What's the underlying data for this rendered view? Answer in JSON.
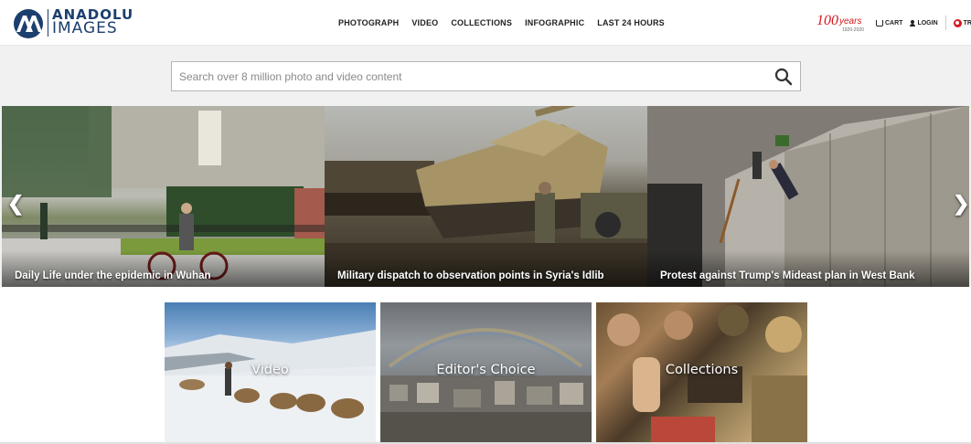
{
  "brand": {
    "line1": "ANADOLU",
    "line2": "IMAGES",
    "logo_mark": "AA"
  },
  "nav": [
    {
      "label": "PHOTOGRAPH"
    },
    {
      "label": "VIDEO"
    },
    {
      "label": "COLLECTIONS"
    },
    {
      "label": "INFOGRAPHIC"
    },
    {
      "label": "LAST 24 HOURS"
    }
  ],
  "anniversary": {
    "number": "100",
    "word": "years",
    "range": "1920-2020"
  },
  "header_right": {
    "cart": "CART",
    "login": "LOGIN",
    "lang": "TR"
  },
  "search": {
    "placeholder": "Search over 8 million photo and video content",
    "value": ""
  },
  "slider": {
    "prev": "❮",
    "next": "❯",
    "slides": [
      {
        "caption": "Daily Life under the epidemic in Wuhan"
      },
      {
        "caption": "Military dispatch to observation points in Syria's Idlib"
      },
      {
        "caption": "Protest against Trump's Mideast plan in West Bank"
      }
    ]
  },
  "categories": [
    {
      "label": "Video"
    },
    {
      "label": "Editor's Choice"
    },
    {
      "label": "Collections"
    }
  ],
  "colors": {
    "brand": "#1b3f6e",
    "accent": "#d71920"
  }
}
